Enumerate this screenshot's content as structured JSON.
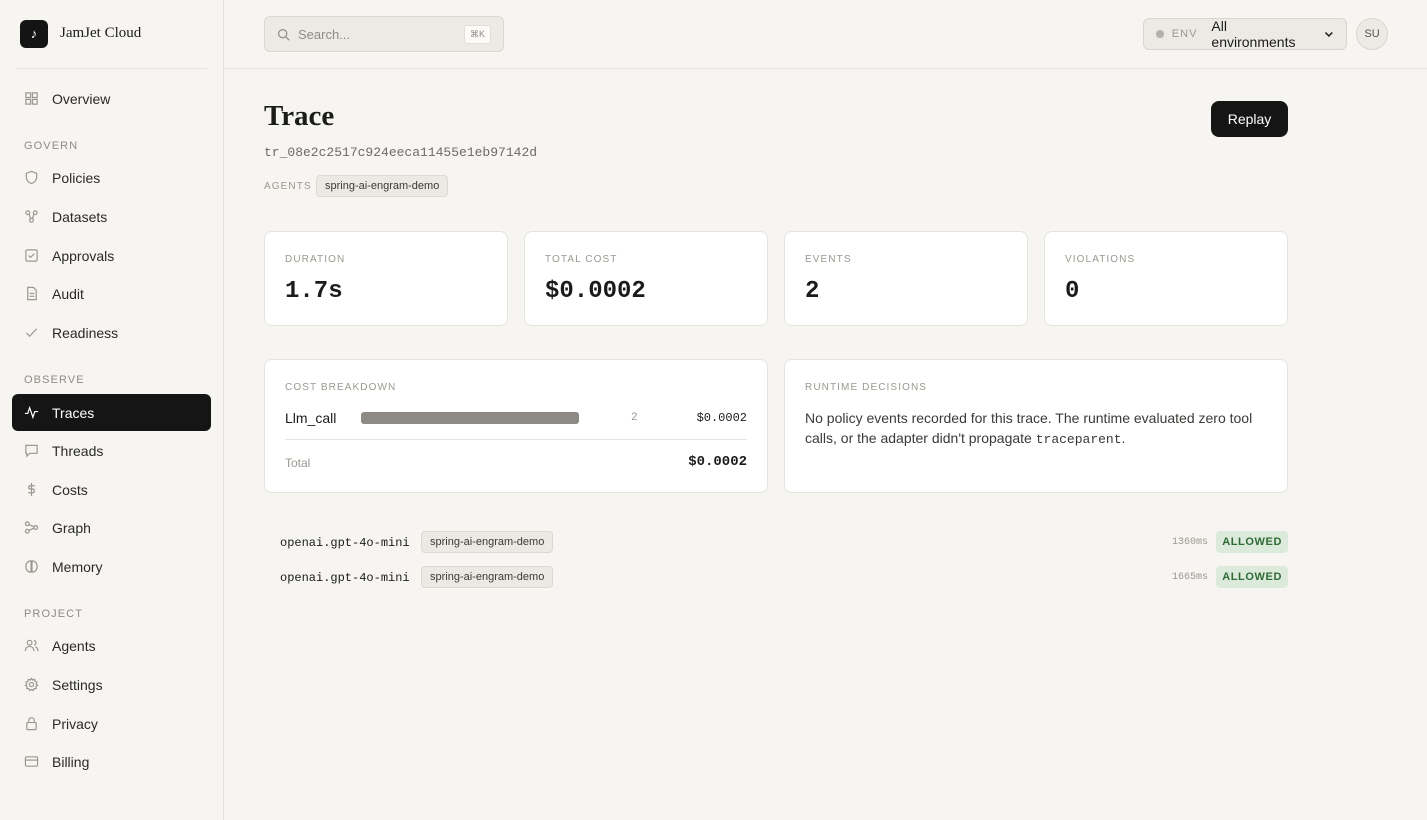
{
  "brand": {
    "logo": "♪",
    "name": "JamJet Cloud"
  },
  "nav": {
    "top": [
      {
        "label": "Overview",
        "icon": "grid-icon"
      }
    ],
    "sections": [
      {
        "label": "GOVERN",
        "items": [
          {
            "label": "Policies",
            "icon": "shield-icon"
          },
          {
            "label": "Datasets",
            "icon": "dataset-icon"
          },
          {
            "label": "Approvals",
            "icon": "approval-icon"
          },
          {
            "label": "Audit",
            "icon": "document-icon"
          },
          {
            "label": "Readiness",
            "icon": "check-icon"
          }
        ]
      },
      {
        "label": "OBSERVE",
        "items": [
          {
            "label": "Traces",
            "icon": "pulse-icon",
            "active": true
          },
          {
            "label": "Threads",
            "icon": "chat-icon"
          },
          {
            "label": "Costs",
            "icon": "dollar-icon"
          },
          {
            "label": "Graph",
            "icon": "graph-icon"
          },
          {
            "label": "Memory",
            "icon": "memory-icon"
          }
        ]
      },
      {
        "label": "PROJECT",
        "items": [
          {
            "label": "Agents",
            "icon": "users-icon"
          },
          {
            "label": "Settings",
            "icon": "gear-icon"
          },
          {
            "label": "Privacy",
            "icon": "lock-icon"
          },
          {
            "label": "Billing",
            "icon": "card-icon"
          }
        ]
      }
    ]
  },
  "topbar": {
    "search_placeholder": "Search...",
    "search_shortcut": "⌘K",
    "env_label": "ENV",
    "env_value": "All environments",
    "avatar_initials": "SU"
  },
  "trace": {
    "title": "Trace",
    "id": "tr_08e2c2517c924eeca11455e1eb97142d",
    "agents_label": "AGENTS",
    "agent": "spring-ai-engram-demo",
    "replay_label": "Replay"
  },
  "stats": [
    {
      "label": "DURATION",
      "value": "1.7s"
    },
    {
      "label": "TOTAL COST",
      "value": "$0.0002"
    },
    {
      "label": "EVENTS",
      "value": "2"
    },
    {
      "label": "VIOLATIONS",
      "value": "0"
    }
  ],
  "cost_breakdown": {
    "label": "COST BREAKDOWN",
    "rows": [
      {
        "name": "Llm_call",
        "count": "2",
        "amount": "$0.0002",
        "fraction": 1.0
      }
    ],
    "total_label": "Total",
    "total_amount": "$0.0002"
  },
  "runtime_decisions": {
    "label": "RUNTIME DECISIONS",
    "text_before": "No policy events recorded for this trace. The runtime evaluated zero tool calls, or the adapter didn't propagate ",
    "code": "traceparent",
    "text_after": "."
  },
  "events": [
    {
      "model": "openai.gpt-4o-mini",
      "agent": "spring-ai-engram-demo",
      "time": "1360ms",
      "status": "ALLOWED"
    },
    {
      "model": "openai.gpt-4o-mini",
      "agent": "spring-ai-engram-demo",
      "time": "1665ms",
      "status": "ALLOWED"
    }
  ]
}
